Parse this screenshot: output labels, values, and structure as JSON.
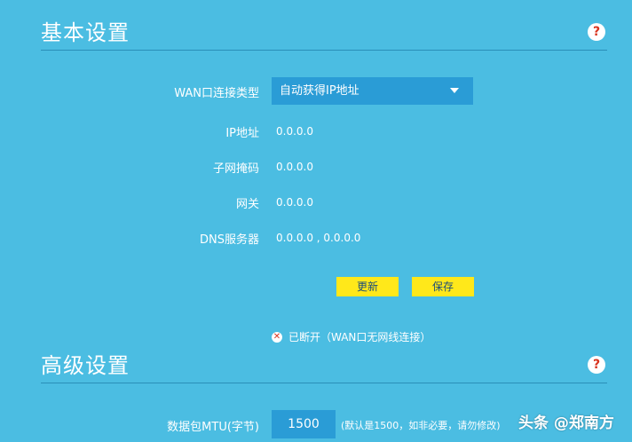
{
  "basic": {
    "title": "基本设置",
    "help": "?",
    "wan_type_label": "WAN口连接类型",
    "wan_type_value": "自动获得IP地址",
    "fields": [
      {
        "label": "IP地址",
        "value": "0.0.0.0"
      },
      {
        "label": "子网掩码",
        "value": "0.0.0.0"
      },
      {
        "label": "网关",
        "value": "0.0.0.0"
      },
      {
        "label": "DNS服务器",
        "value": "0.0.0.0 , 0.0.0.0"
      }
    ],
    "refresh_label": "更新",
    "save_label": "保存",
    "status_icon": "✕",
    "status_text": "已断开（WAN口无网线连接）"
  },
  "advanced": {
    "title": "高级设置",
    "help": "?",
    "mtu_label": "数据包MTU(字节)",
    "mtu_value": "1500",
    "mtu_hint": "(默认是1500，如非必要，请勿修改)"
  },
  "watermark": "头条 @郑南方",
  "colors": {
    "background": "#4bbde2",
    "select_bg": "#2a9cd6",
    "button_bg": "#ffe81a",
    "help_icon": "#d9341f"
  }
}
